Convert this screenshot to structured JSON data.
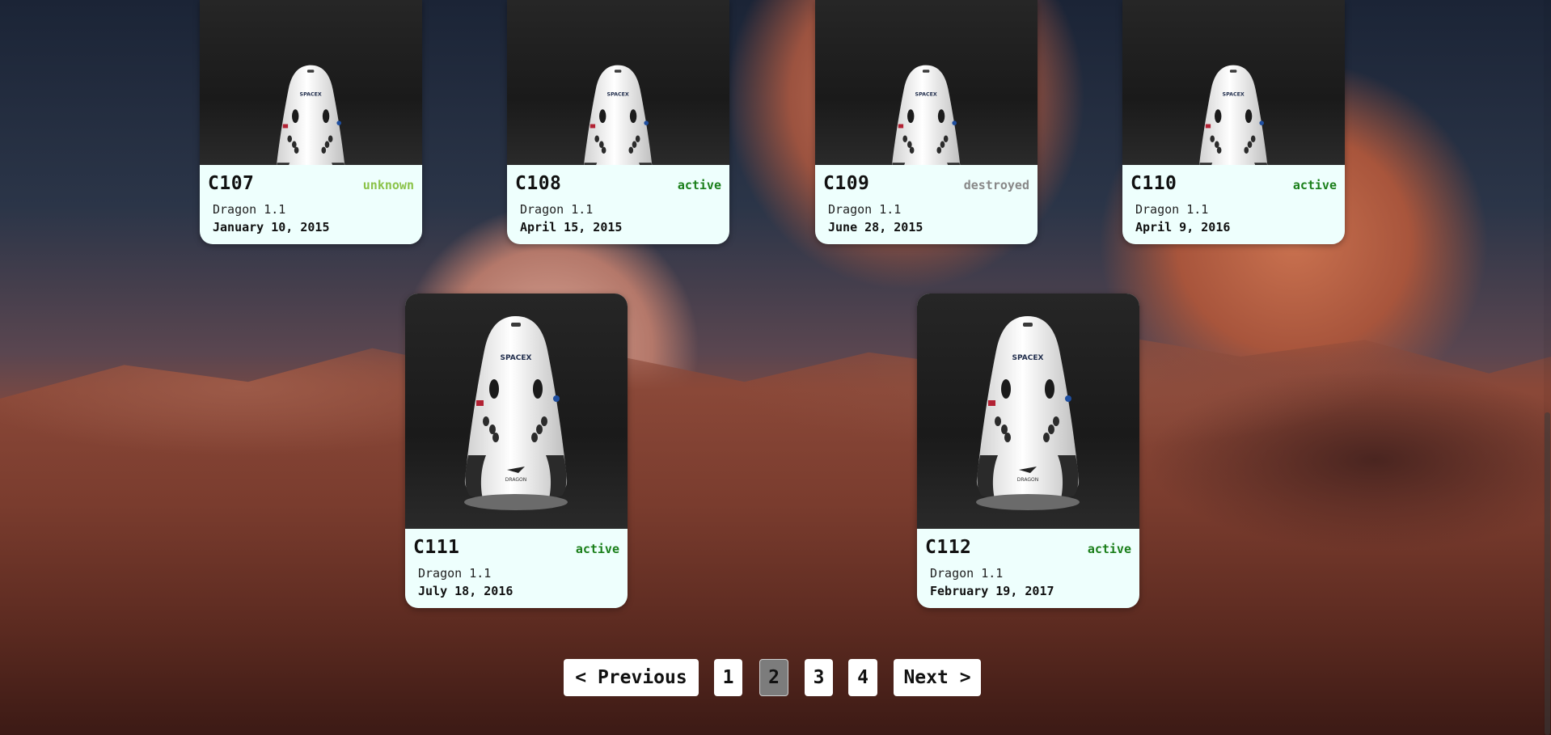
{
  "capsules": [
    {
      "serial": "C107",
      "status": "unknown",
      "type": "Dragon 1.1",
      "date": "January 10, 2015"
    },
    {
      "serial": "C108",
      "status": "active",
      "type": "Dragon 1.1",
      "date": "April 15, 2015"
    },
    {
      "serial": "C109",
      "status": "destroyed",
      "type": "Dragon 1.1",
      "date": "June 28, 2015"
    },
    {
      "serial": "C110",
      "status": "active",
      "type": "Dragon 1.1",
      "date": "April 9, 2016"
    },
    {
      "serial": "C111",
      "status": "active",
      "type": "Dragon 1.1",
      "date": "July 18, 2016"
    },
    {
      "serial": "C112",
      "status": "active",
      "type": "Dragon 1.1",
      "date": "February 19, 2017"
    }
  ],
  "capsule_image": {
    "brand": "SPACEX",
    "name": "DRAGON"
  },
  "status_colors": {
    "unknown": "#8bc34a",
    "active": "#1a7f1a",
    "destroyed": "#888888"
  },
  "pagination": {
    "previous": "< Previous",
    "pages": [
      "1",
      "2",
      "3",
      "4"
    ],
    "current": "2",
    "next": "Next >"
  }
}
